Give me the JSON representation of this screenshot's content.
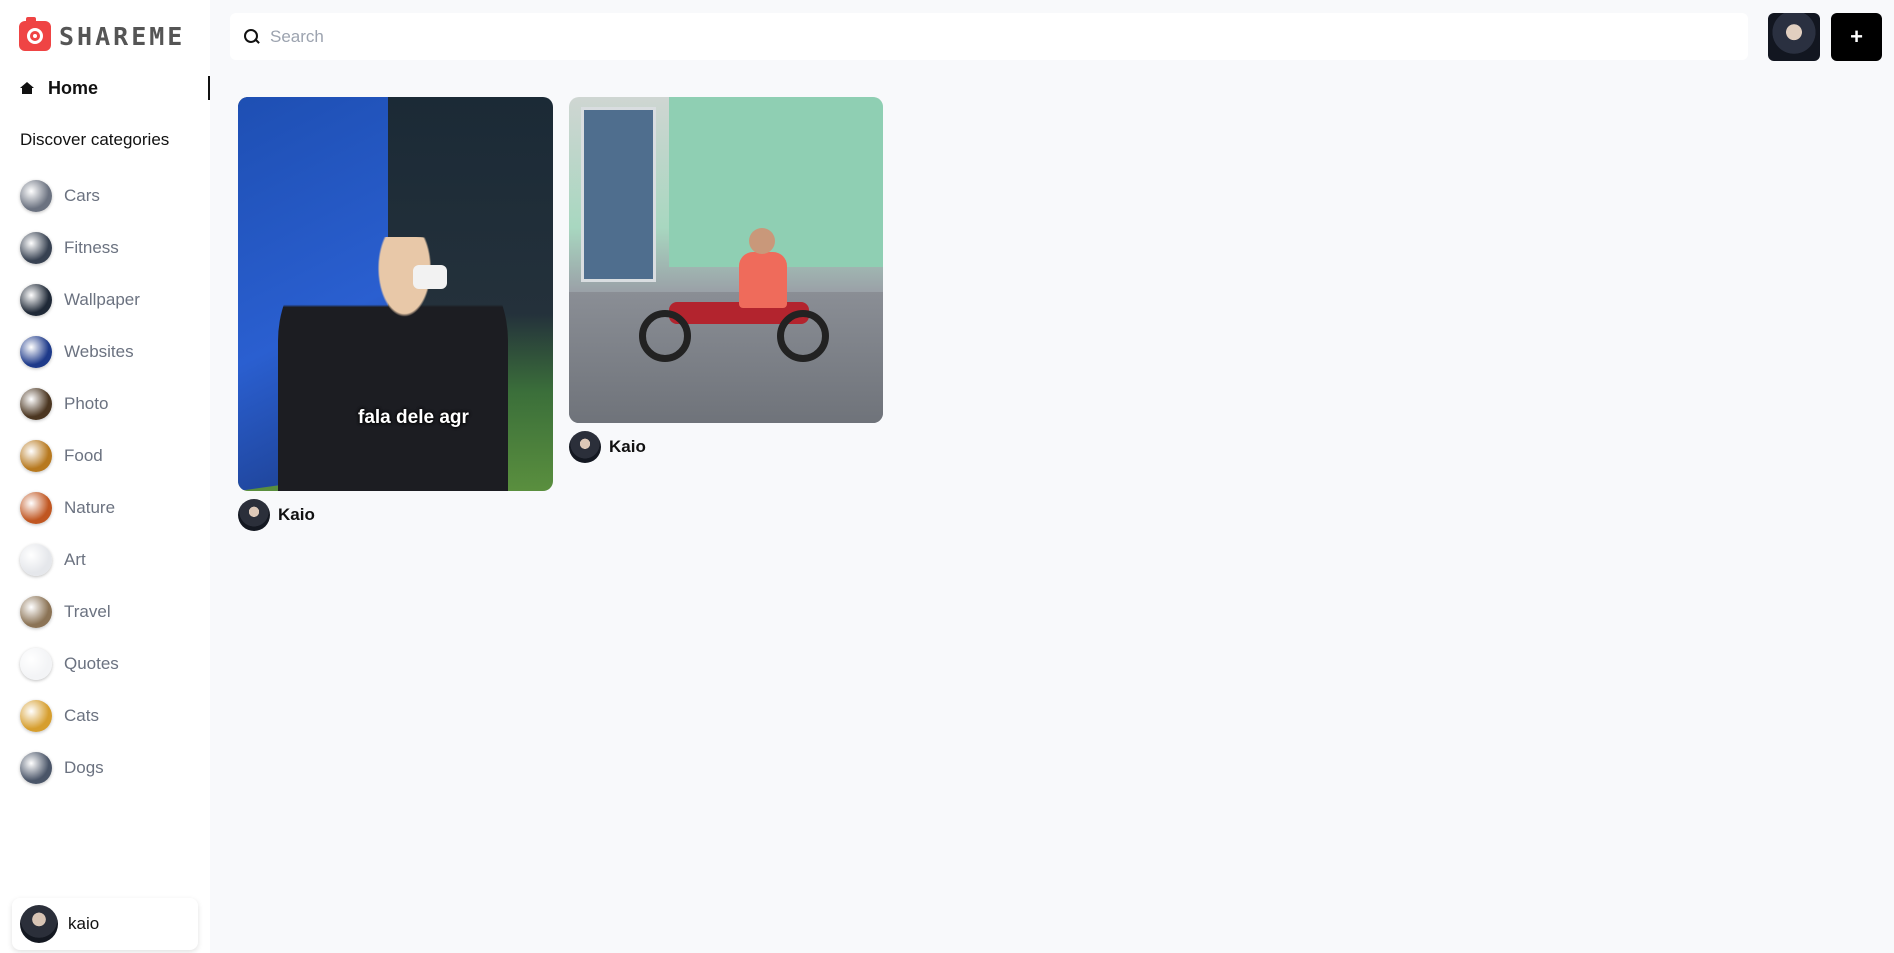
{
  "app": {
    "logo_text": "SHAREME"
  },
  "sidebar": {
    "home_label": "Home",
    "discover_heading": "Discover categories",
    "categories": [
      {
        "label": "Cars",
        "color": "#6b7280"
      },
      {
        "label": "Fitness",
        "color": "#374151"
      },
      {
        "label": "Wallpaper",
        "color": "#1f2937"
      },
      {
        "label": "Websites",
        "color": "#1e3a8a"
      },
      {
        "label": "Photo",
        "color": "#4b3621"
      },
      {
        "label": "Food",
        "color": "#b7791f"
      },
      {
        "label": "Nature",
        "color": "#c05621"
      },
      {
        "label": "Art",
        "color": "#e5e7eb"
      },
      {
        "label": "Travel",
        "color": "#8b7355"
      },
      {
        "label": "Quotes",
        "color": "#f3f4f6"
      },
      {
        "label": "Cats",
        "color": "#d69e2e"
      },
      {
        "label": "Dogs",
        "color": "#4a5568"
      }
    ],
    "user_name": "kaio"
  },
  "search": {
    "placeholder": "Search",
    "value": ""
  },
  "header": {
    "add_label": "+"
  },
  "pins": [
    {
      "caption": "fala dele agr",
      "user": "Kaio"
    },
    {
      "user": "Kaio"
    }
  ]
}
